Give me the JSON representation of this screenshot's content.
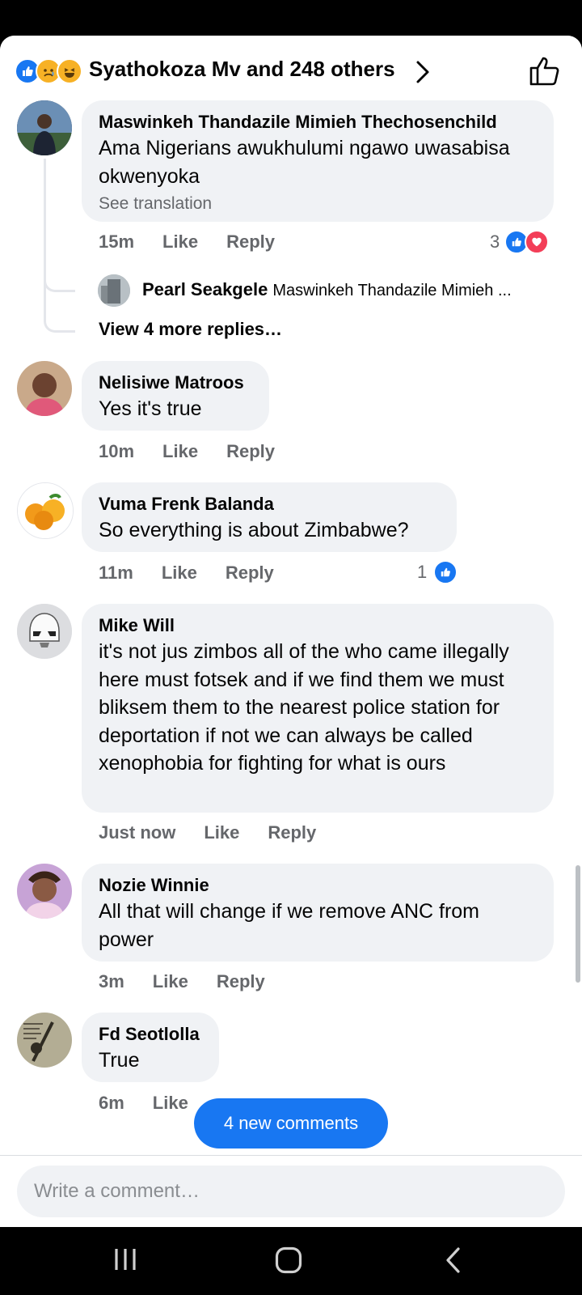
{
  "header": {
    "reaction_icons": [
      "like-icon",
      "sad-icon",
      "haha-icon"
    ],
    "title": "Syathokoza Mv and 248 others"
  },
  "comments": [
    {
      "name": "Maswinkeh Thandazile Mimieh Thechosenchild",
      "text": "Ama Nigerians awukhulumi ngawo uwasabisa okwenyoka",
      "translation_link": "See translation",
      "time": "15m",
      "like_label": "Like",
      "reply_label": "Reply",
      "reaction_count": "3",
      "reaction_icons": [
        "like-icon",
        "love-icon"
      ]
    },
    {
      "name": "Nelisiwe Matroos",
      "text": "Yes it's true",
      "time": "10m",
      "like_label": "Like",
      "reply_label": "Reply"
    },
    {
      "name": "Vuma Frenk Balanda",
      "text": "So everything is about Zimbabwe?",
      "time": "11m",
      "like_label": "Like",
      "reply_label": "Reply",
      "reaction_count": "1",
      "reaction_icons": [
        "like-icon"
      ]
    },
    {
      "name": "Mike Will",
      "text": "it's not jus zimbos all of the who came illegally here must fotsek and if we find them we must bliksem them to the nearest police station for deportation if not we can always be called xenophobia for fighting for what is ours",
      "time": "Just now",
      "like_label": "Like",
      "reply_label": "Reply"
    },
    {
      "name": "Nozie Winnie",
      "text": "All that will change if we remove ANC from power",
      "time": "3m",
      "like_label": "Like",
      "reply_label": "Reply"
    },
    {
      "name": "Fd Seotlolla",
      "text": "True",
      "time": "6m",
      "like_label": "Like"
    }
  ],
  "reply_preview": {
    "name": "Pearl Seakgele",
    "text": "Maswinkeh Thandazile Mimieh ..."
  },
  "view_more_replies": "View 4 more replies…",
  "new_comments_pill": "4 new comments",
  "composer": {
    "placeholder": "Write a comment…"
  },
  "colors": {
    "accent": "#1877f2",
    "love": "#f33e58",
    "bubble": "#f0f2f5",
    "muted_text": "#65676b"
  }
}
